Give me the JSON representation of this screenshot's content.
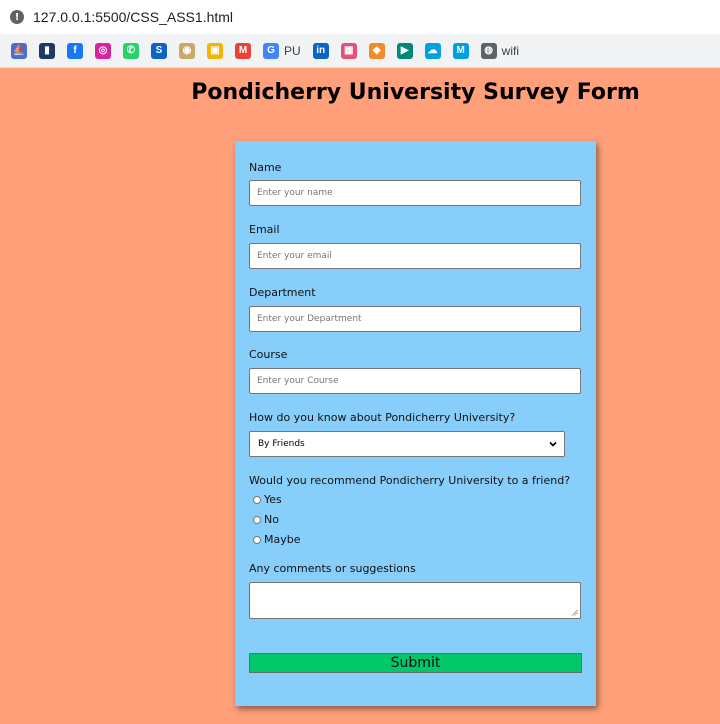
{
  "browser": {
    "url": "127.0.0.1:5500/CSS_ASS1.html",
    "bookmarks": [
      {
        "icon": "sailboat-icon",
        "label": "",
        "color": "#4a6cd4",
        "glyph": "⛵"
      },
      {
        "icon": "bookmark-icon",
        "label": "",
        "color": "#1e3a5f",
        "glyph": "▮"
      },
      {
        "icon": "facebook-icon",
        "label": "",
        "color": "#1877f2",
        "glyph": "f"
      },
      {
        "icon": "instagram-icon",
        "label": "",
        "color": "#d6249f",
        "glyph": "◎"
      },
      {
        "icon": "whatsapp-icon",
        "label": "",
        "color": "#25d366",
        "glyph": "✆"
      },
      {
        "icon": "s-icon",
        "label": "",
        "color": "#0a66c2",
        "glyph": "S"
      },
      {
        "icon": "seal-icon",
        "label": "",
        "color": "#c9a86a",
        "glyph": "◉"
      },
      {
        "icon": "contacts-icon",
        "label": "",
        "color": "#f4b400",
        "glyph": "▣"
      },
      {
        "icon": "gmail-icon",
        "label": "",
        "color": "#ea4335",
        "glyph": "M"
      },
      {
        "icon": "google-icon",
        "label": "PU",
        "color": "#4285f4",
        "glyph": "G"
      },
      {
        "icon": "linkedin-icon",
        "label": "",
        "color": "#0a66c2",
        "glyph": "in"
      },
      {
        "icon": "grid-icon",
        "label": "",
        "color": "#e94e77",
        "glyph": "▦"
      },
      {
        "icon": "cube-icon",
        "label": "",
        "color": "#f28c28",
        "glyph": "◆"
      },
      {
        "icon": "meet-icon",
        "label": "",
        "color": "#00897b",
        "glyph": "▶"
      },
      {
        "icon": "salesforce-icon",
        "label": "",
        "color": "#00a1e0",
        "glyph": "☁"
      },
      {
        "icon": "mulesoft-icon",
        "label": "",
        "color": "#00a0df",
        "glyph": "M"
      },
      {
        "icon": "globe-icon",
        "label": "wifi",
        "color": "#5f6368",
        "glyph": "◍"
      }
    ]
  },
  "page": {
    "title": "Pondicherry University Survey Form"
  },
  "form": {
    "name_label": "Name",
    "name_placeholder": "Enter your name",
    "email_label": "Email",
    "email_placeholder": "Enter your email",
    "department_label": "Department",
    "department_placeholder": "Enter your Department",
    "course_label": "Course",
    "course_placeholder": "Enter your Course",
    "know_label": "How do you know about Pondicherry University?",
    "know_selected": "By Friends",
    "recommend_label": "Would you recommend Pondicherry University to a friend?",
    "recommend_options": [
      "Yes",
      "No",
      "Maybe"
    ],
    "comments_label": "Any comments or suggestions",
    "submit_label": "Submit"
  },
  "colors": {
    "page_background": "#ffa07a",
    "form_background": "#87cefa",
    "submit_background": "#00c86a"
  }
}
